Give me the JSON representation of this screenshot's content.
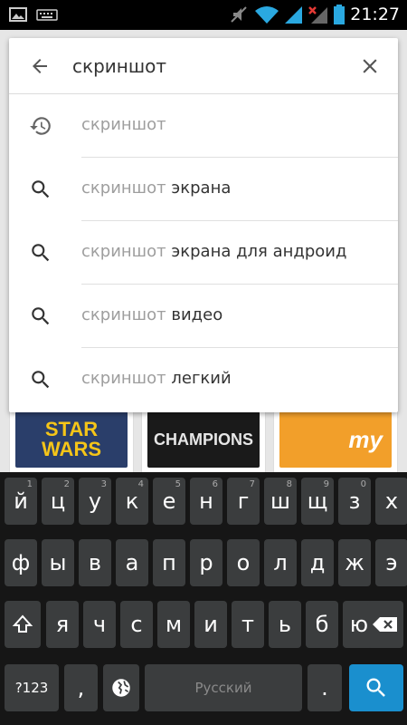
{
  "status_bar": {
    "time": "21:27",
    "left_icons": [
      "image-icon",
      "keyboard-icon"
    ],
    "right_icons": [
      "mute-icon",
      "wifi-icon",
      "signal-icon",
      "signal-no-sim-icon",
      "battery-icon"
    ]
  },
  "search": {
    "query": "скриншот",
    "back_icon": "arrow-back-icon",
    "clear_icon": "close-icon"
  },
  "suggestions": [
    {
      "icon": "history-icon",
      "query": "скриншот",
      "rest": ""
    },
    {
      "icon": "search-icon",
      "query": "скриншот",
      "rest": " экрана"
    },
    {
      "icon": "search-icon",
      "query": "скриншот",
      "rest": " экрана для андроид"
    },
    {
      "icon": "search-icon",
      "query": "скриншот",
      "rest": " видео"
    },
    {
      "icon": "search-icon",
      "query": "скриншот",
      "rest": " легкий"
    }
  ],
  "background_apps": [
    {
      "thumb_text": "STAR WARS",
      "bg": "#2a3e6a",
      "fg": "#f5c518"
    },
    {
      "thumb_text": "CHAMPIONS",
      "bg": "#1a1a1a",
      "fg": "#e6e6e6"
    },
    {
      "thumb_text": "my",
      "bg": "#f29f2a",
      "fg": "#ffffff"
    }
  ],
  "keyboard": {
    "row1": [
      {
        "label": "й",
        "hint": "1"
      },
      {
        "label": "ц",
        "hint": "2"
      },
      {
        "label": "у",
        "hint": "3"
      },
      {
        "label": "к",
        "hint": "4"
      },
      {
        "label": "е",
        "hint": "5"
      },
      {
        "label": "н",
        "hint": "6"
      },
      {
        "label": "г",
        "hint": "7"
      },
      {
        "label": "ш",
        "hint": "8"
      },
      {
        "label": "щ",
        "hint": "9"
      },
      {
        "label": "з",
        "hint": "0"
      },
      {
        "label": "х",
        "hint": ""
      }
    ],
    "row2": [
      "ф",
      "ы",
      "в",
      "а",
      "п",
      "р",
      "о",
      "л",
      "д",
      "ж",
      "э"
    ],
    "row3": [
      "я",
      "ч",
      "с",
      "м",
      "и",
      "т",
      "ь",
      "б",
      "ю"
    ],
    "numbers_label": "?123",
    "comma_label": ",",
    "space_label": "Русский",
    "period_label": ".",
    "colors": {
      "keyboard_bg": "#161616",
      "key_bg": "#3b3d3e",
      "search_key": "#1a8fce"
    }
  }
}
